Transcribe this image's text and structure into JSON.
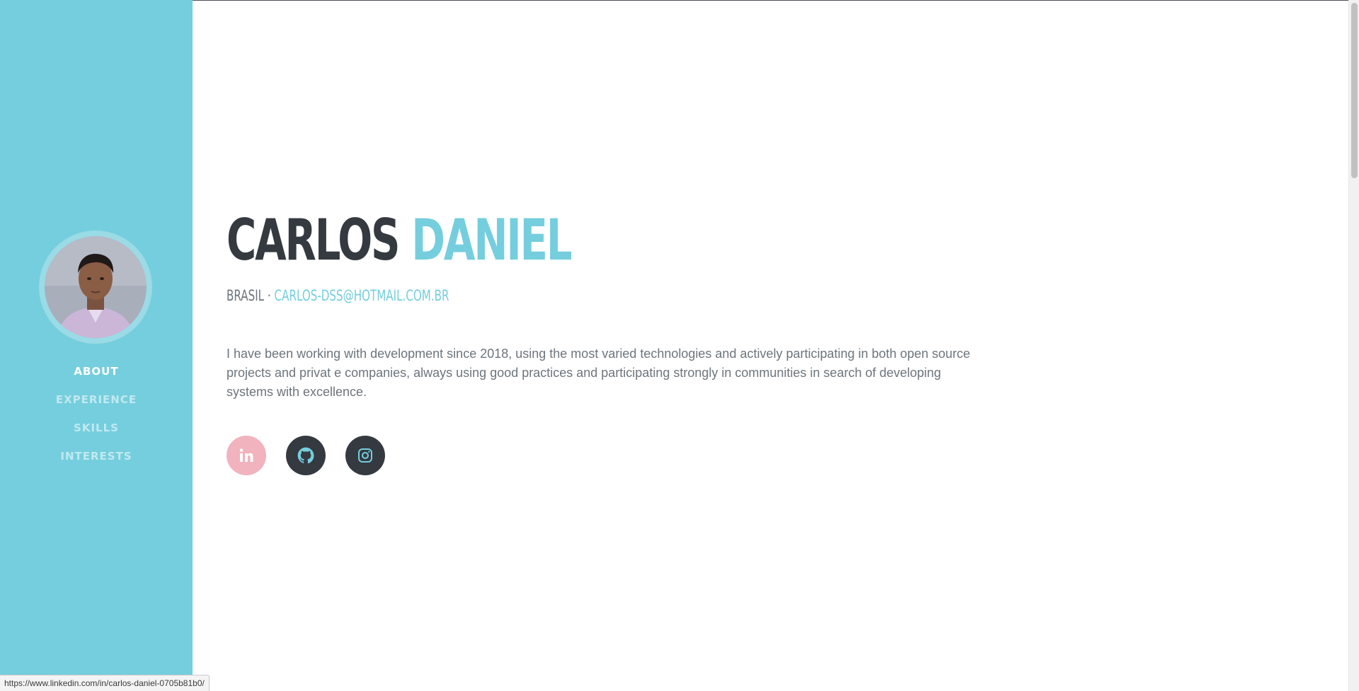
{
  "profile": {
    "first_name": "CARLOS",
    "last_name": "DANIEL",
    "location": "BRASIL",
    "separator": "·",
    "email": "CARLOS-DSS@HOTMAIL.COM.BR",
    "about": "I have been working with development since 2018, using the most varied technologies and actively participating in both open source projects and privat e companies, always using good practices and participating strongly in communities in search of developing systems with excellence."
  },
  "nav": {
    "items": [
      {
        "label": "ABOUT",
        "active": true
      },
      {
        "label": "EXPERIENCE",
        "active": false
      },
      {
        "label": "SKILLS",
        "active": false
      },
      {
        "label": "INTERESTS",
        "active": false
      }
    ]
  },
  "social": [
    {
      "icon": "linkedin-icon",
      "state": "hover"
    },
    {
      "icon": "github-icon",
      "state": "normal"
    },
    {
      "icon": "instagram-icon",
      "state": "normal"
    }
  ],
  "status_bar": {
    "url": "https://www.linkedin.com/in/carlos-daniel-0705b81b0/"
  },
  "colors": {
    "sidebar": "#75cedd",
    "accent": "#75cedd",
    "dark": "#343a40",
    "text": "#6c757d",
    "social_hover": "#f1b3bd"
  }
}
